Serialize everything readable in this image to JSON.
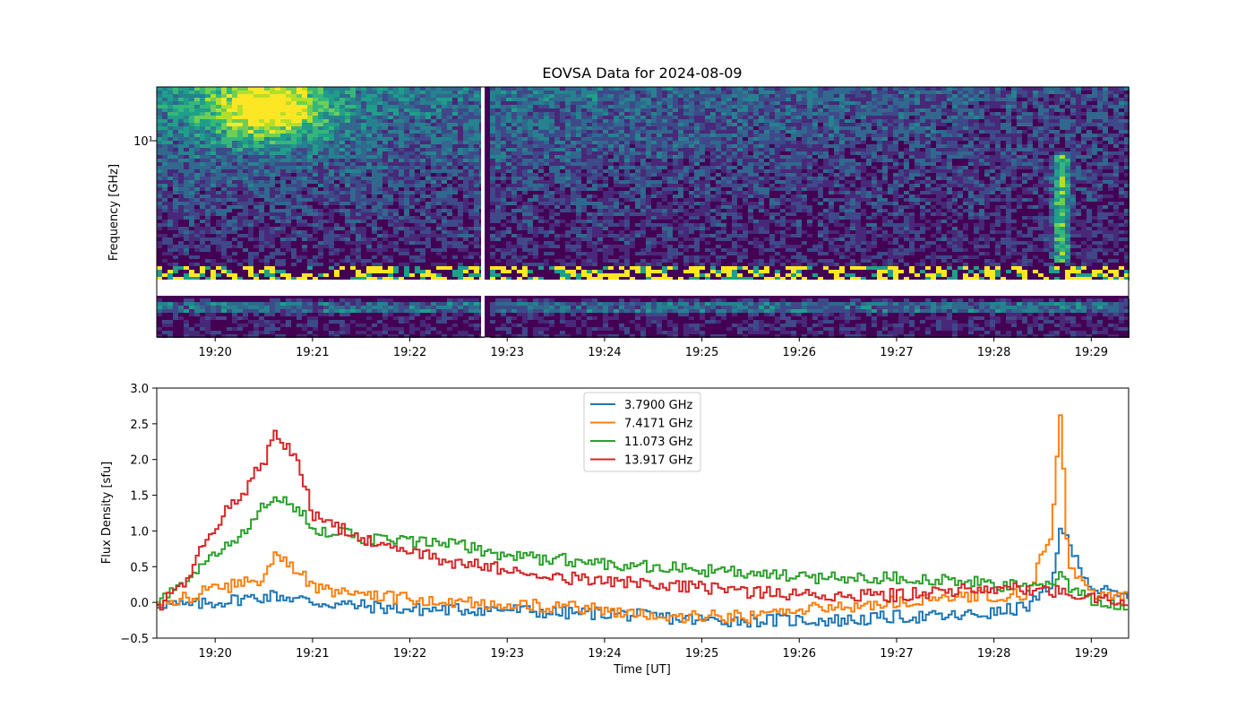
{
  "chart_data": [
    {
      "type": "heatmap",
      "title": "EOVSA Data for 2024-08-09",
      "xlabel": "",
      "ylabel": "Frequency [GHz]",
      "x_tick_labels": [
        "19:20",
        "19:21",
        "19:22",
        "19:23",
        "19:24",
        "19:25",
        "19:26",
        "19:27",
        "19:28",
        "19:29"
      ],
      "y_tick_labels": [
        "10¹"
      ],
      "y_scale": "log",
      "colormap": "viridis",
      "features": {
        "bright_emission_start": "19:20",
        "bright_emission_end": "19:21",
        "data_gap_time": "19:22:45",
        "late_burst_time": "19:28:40"
      }
    },
    {
      "type": "line",
      "title": "",
      "xlabel": "Time [UT]",
      "ylabel": "Flux Density [sfu]",
      "ylim": [
        -0.5,
        3.0
      ],
      "x_range": [
        "19:19:24",
        "19:29:23"
      ],
      "y_ticks": [
        -0.5,
        0.0,
        0.5,
        1.0,
        1.5,
        2.0,
        2.5,
        3.0
      ],
      "y_tick_labels": [
        "−0.5",
        "0.0",
        "0.5",
        "1.0",
        "1.5",
        "2.0",
        "2.5",
        "3.0"
      ],
      "x_tick_labels": [
        "19:20",
        "19:21",
        "19:22",
        "19:23",
        "19:24",
        "19:25",
        "19:26",
        "19:27",
        "19:28",
        "19:29"
      ],
      "legend_position": "top-center",
      "grid": false,
      "x_times": [
        "19:19:24",
        "19:19:40",
        "19:20:00",
        "19:20:15",
        "19:20:30",
        "19:20:36",
        "19:20:50",
        "19:21:00",
        "19:21:30",
        "19:22:00",
        "19:22:30",
        "19:23:00",
        "19:23:30",
        "19:24:00",
        "19:24:30",
        "19:25:00",
        "19:25:30",
        "19:26:00",
        "19:26:30",
        "19:27:00",
        "19:27:30",
        "19:28:00",
        "19:28:20",
        "19:28:35",
        "19:28:40",
        "19:28:45",
        "19:29:00",
        "19:29:23"
      ],
      "series": [
        {
          "name": "3.7900 GHz",
          "color": "#1f77b4",
          "values": [
            0.0,
            -0.05,
            0.0,
            0.05,
            0.08,
            0.1,
            0.05,
            0.0,
            -0.05,
            -0.1,
            -0.1,
            -0.1,
            -0.15,
            -0.15,
            -0.2,
            -0.25,
            -0.25,
            -0.25,
            -0.25,
            -0.2,
            -0.2,
            -0.15,
            -0.05,
            0.2,
            1.1,
            0.8,
            0.2,
            0.05
          ]
        },
        {
          "name": "7.4171 GHz",
          "color": "#ff7f0e",
          "values": [
            -0.05,
            0.05,
            0.2,
            0.25,
            0.35,
            0.75,
            0.45,
            0.2,
            0.1,
            0.05,
            0.0,
            -0.05,
            -0.05,
            -0.1,
            -0.2,
            -0.2,
            -0.2,
            -0.1,
            -0.05,
            0.0,
            0.05,
            0.1,
            0.1,
            1.0,
            2.7,
            0.5,
            0.1,
            0.05
          ]
        },
        {
          "name": "11.073 GHz",
          "color": "#2ca02c",
          "values": [
            -0.05,
            0.3,
            0.7,
            0.95,
            1.35,
            1.45,
            1.3,
            1.05,
            0.9,
            0.85,
            0.8,
            0.65,
            0.6,
            0.55,
            0.5,
            0.45,
            0.4,
            0.35,
            0.35,
            0.35,
            0.3,
            0.25,
            0.2,
            0.3,
            0.4,
            0.2,
            0.05,
            -0.1
          ]
        },
        {
          "name": "13.917 GHz",
          "color": "#d62728",
          "values": [
            -0.1,
            0.3,
            1.1,
            1.5,
            2.0,
            2.4,
            2.0,
            1.2,
            0.9,
            0.7,
            0.55,
            0.45,
            0.35,
            0.3,
            0.25,
            0.2,
            0.15,
            0.1,
            0.1,
            0.1,
            0.15,
            0.2,
            0.2,
            0.15,
            0.2,
            0.1,
            0.05,
            0.05
          ]
        }
      ]
    }
  ]
}
